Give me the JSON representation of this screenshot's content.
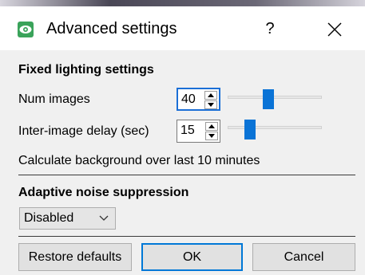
{
  "dialog": {
    "title": "Advanced settings",
    "help_label": "?",
    "close_icon": "close-icon",
    "app_icon": "eye-logo-icon"
  },
  "fixed_lighting": {
    "heading": "Fixed lighting settings",
    "num_images": {
      "label": "Num images",
      "value": "40",
      "slider_fraction": 0.42
    },
    "inter_image_delay": {
      "label": "Inter-image delay (sec)",
      "value": "15",
      "slider_fraction": 0.2
    },
    "background_note": "Calculate background over last 10 minutes"
  },
  "adaptive_noise": {
    "heading": "Adaptive noise suppression",
    "selected": "Disabled"
  },
  "buttons": {
    "restore_defaults": "Restore defaults",
    "ok": "OK",
    "cancel": "Cancel"
  },
  "colors": {
    "accent": "#0078d7",
    "slider_thumb": "#0a73d6",
    "app_icon": "#3aa35a"
  }
}
